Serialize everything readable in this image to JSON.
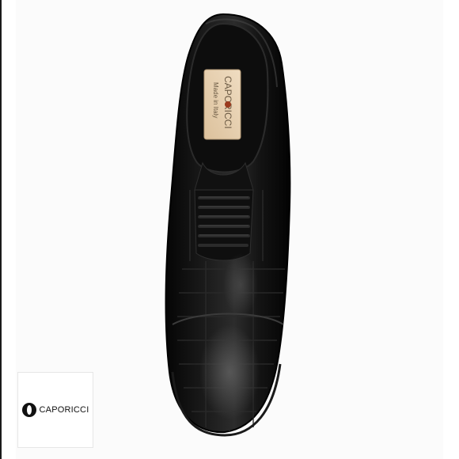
{
  "product_image": {
    "alt_icon": "oxford-shoe-photo",
    "insole_brand": "CAPORICCI",
    "insole_tagline": "Made in Italy",
    "colors": {
      "leather": "#0b0b0b",
      "insole": "#e8d2b4",
      "background": "#fbfbfb"
    }
  },
  "logo_card": {
    "icon": "caporicci-logo-mark",
    "brand": "CAPORICCI"
  }
}
